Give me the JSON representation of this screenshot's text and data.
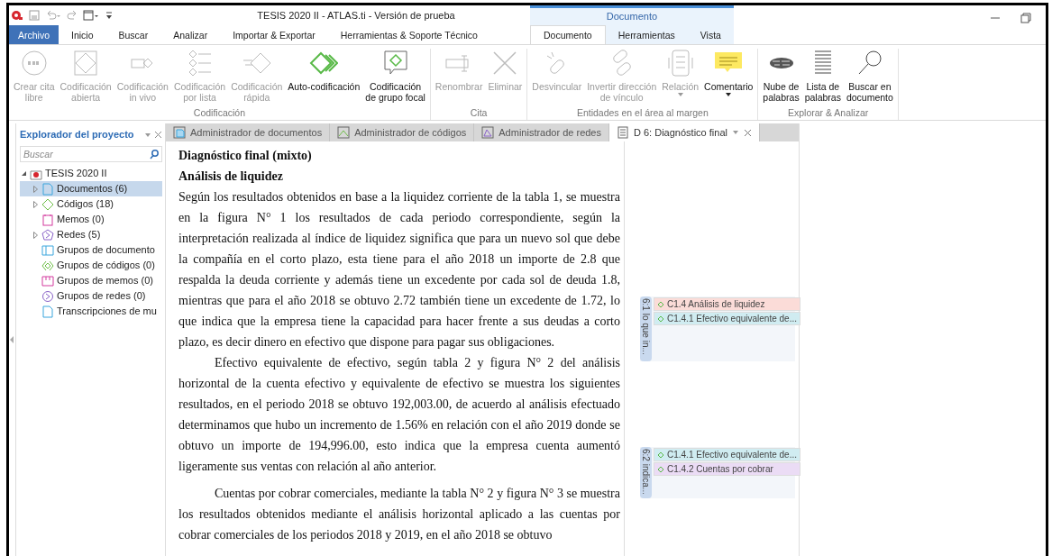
{
  "window": {
    "title": "TESIS 2020 II - ATLAS.ti - Versión de prueba"
  },
  "menu_tabs": [
    {
      "label": "Archivo",
      "kind": "file"
    },
    {
      "label": "Inicio",
      "kind": "normal"
    },
    {
      "label": "Buscar",
      "kind": "normal"
    },
    {
      "label": "Analizar",
      "kind": "normal"
    },
    {
      "label": "Importar & Exportar",
      "kind": "normal"
    },
    {
      "label": "Herramientas & Soporte Técnico",
      "kind": "normal"
    }
  ],
  "contextual_group": {
    "title": "Documento",
    "tabs": [
      {
        "label": "Documento",
        "selected": true
      },
      {
        "label": "Herramientas",
        "selected": false
      },
      {
        "label": "Vista",
        "selected": false
      }
    ]
  },
  "ribbon": [
    {
      "label": "Codificación",
      "buttons": [
        {
          "label": "Crear cita\nlibre",
          "disabled": true
        },
        {
          "label": "Codificación\nabierta",
          "disabled": true
        },
        {
          "label": "Codificación\nin vivo",
          "disabled": true
        },
        {
          "label": "Codificación\npor lista",
          "disabled": true
        },
        {
          "label": "Codificación\nrápida",
          "disabled": true
        },
        {
          "label": "Auto-codificación",
          "disabled": false
        },
        {
          "label": "Codificación\nde grupo focal",
          "disabled": false
        }
      ]
    },
    {
      "label": "Cita",
      "buttons": [
        {
          "label": "Renombrar",
          "disabled": true
        },
        {
          "label": "Eliminar",
          "disabled": true
        }
      ]
    },
    {
      "label": "Entidades en el área al margen",
      "buttons": [
        {
          "label": "Desvincular",
          "disabled": true
        },
        {
          "label": "Invertir dirección\nde vínculo",
          "disabled": true
        },
        {
          "label": "Relación",
          "disabled": true,
          "dropdown": true
        },
        {
          "label": "Comentario",
          "disabled": false,
          "dropdown": true
        }
      ]
    },
    {
      "label": "Explorar & Analizar",
      "buttons": [
        {
          "label": "Nube de\npalabras",
          "disabled": false
        },
        {
          "label": "Lista de\npalabras",
          "disabled": false
        },
        {
          "label": "Buscar en\ndocumento",
          "disabled": false
        }
      ]
    }
  ],
  "explorer": {
    "title": "Explorador del proyecto",
    "search": {
      "placeholder": "Buscar"
    },
    "root": {
      "label": "TESIS 2020 II",
      "expanded": true,
      "children": [
        {
          "label": "Documentos (6)",
          "kind": "documents",
          "expanded": false,
          "selected": true
        },
        {
          "label": "Códigos (18)",
          "kind": "codes",
          "expanded": false,
          "selected": false
        },
        {
          "label": "Memos (0)",
          "kind": "memos",
          "selected": false
        },
        {
          "label": "Redes (5)",
          "kind": "networks",
          "expanded": false,
          "selected": false
        },
        {
          "label": "Grupos de documento",
          "kind": "document-groups",
          "selected": false
        },
        {
          "label": "Grupos de códigos (0)",
          "kind": "code-groups",
          "selected": false
        },
        {
          "label": "Grupos de memos (0)",
          "kind": "memo-groups",
          "selected": false
        },
        {
          "label": "Grupos de redes (0)",
          "kind": "network-groups",
          "selected": false
        },
        {
          "label": "Transcripciones de mu",
          "kind": "transcripts",
          "selected": false
        }
      ]
    }
  },
  "doc_tabs": [
    {
      "label": "Administrador de documentos",
      "kind": "documents",
      "selected": false
    },
    {
      "label": "Administrador de códigos",
      "kind": "codes",
      "selected": false
    },
    {
      "label": "Administrador de redes",
      "kind": "networks",
      "selected": false
    },
    {
      "label": "D 6: Diagnóstico final",
      "kind": "document",
      "selected": true
    }
  ],
  "document": {
    "title": "Diagnóstico final (mixto)",
    "heading": "Análisis de liquidez",
    "paragraphs": [
      {
        "indent": false,
        "text": "Según los resultados obtenidos en base a la liquidez corriente de la tabla 1, se muestra en la figura N° 1 los resultados de cada periodo correspondiente, según la interpretación realizada al índice de liquidez significa que para un nuevo sol que debe la compañía en el corto plazo, esta tiene para el año 2018 un importe de 2.8 que respalda la deuda corriente y además tiene un excedente por cada sol de deuda 1.8, mientras que para el año 2018 se obtuvo 2.72 también tiene un excedente de 1.72, lo que indica que la empresa tiene la capacidad para hacer frente a sus deudas a corto plazo, es decir dinero en efectivo que dispone para pagar sus obligaciones."
      },
      {
        "indent": true,
        "text": "Efectivo equivalente de efectivo, según tabla 2 y figura N° 2 del análisis horizontal de la cuenta efectivo y equivalente de efectivo se muestra los siguientes resultados, en el periodo 2018 se obtuvo 192,003.00, de acuerdo al análisis efectuado determinamos que hubo un incremento de 1.56% en relación con el año 2019 donde se obtuvo un importe de 194,996.00, esto indica que la empresa cuenta aumentó ligeramente sus ventas con relación al año anterior."
      },
      {
        "indent": true,
        "text": "Cuentas por cobrar comerciales, mediante la tabla N° 2 y figura N° 3 se muestra los resultados obtenidos mediante el análisis horizontal aplicado a las cuentas por cobrar comerciales de los periodos 2018 y 2019, en el año 2018 se obtuvo"
      }
    ]
  },
  "margin": {
    "quotations": [
      {
        "label": "6:1 lo que in...",
        "codes": [
          {
            "label": "C1.4 Análisis de liquidez",
            "color": "#fbdcd8"
          },
          {
            "label": "C1.4.1 Efectivo equivalente de...",
            "color": "#d0ecf1"
          }
        ]
      },
      {
        "label": "6:2 indica...",
        "codes": [
          {
            "label": "C1.4.1 Efectivo equivalente de...",
            "color": "#d0ecf1"
          },
          {
            "label": "C1.4.2 Cuentas por cobrar",
            "color": "#ebdcf5"
          }
        ]
      }
    ]
  }
}
